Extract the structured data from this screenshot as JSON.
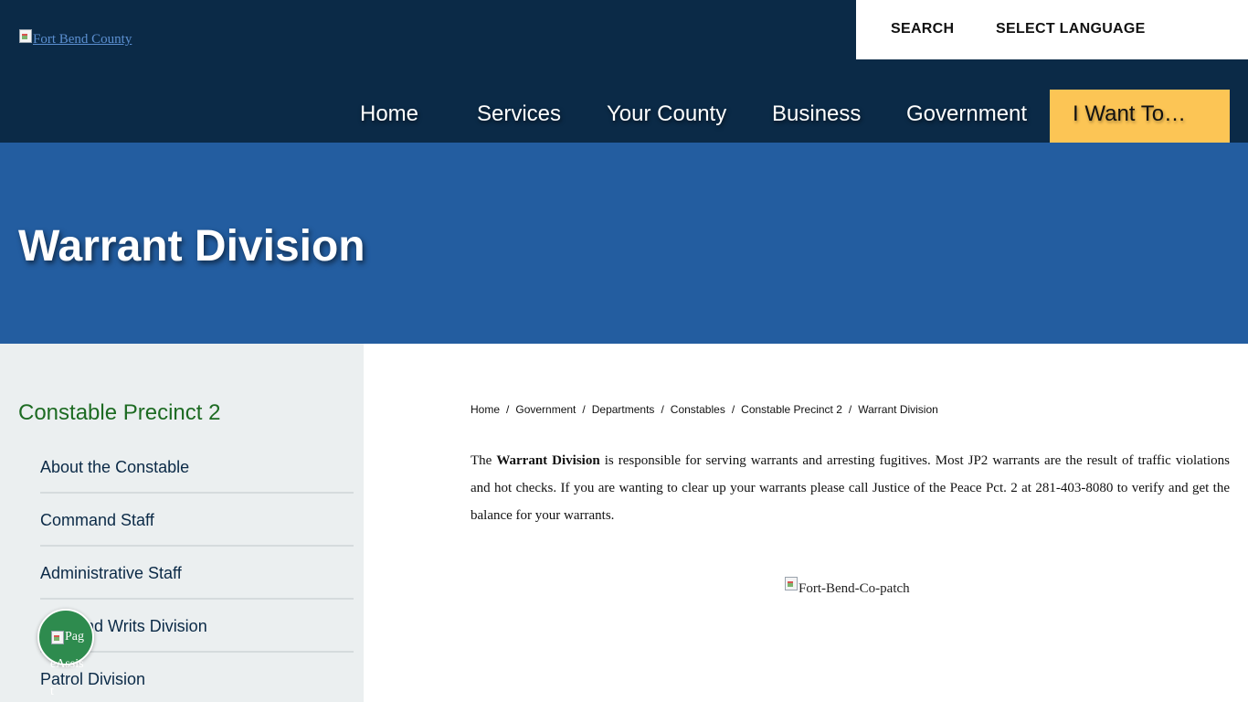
{
  "header": {
    "logo_alt": "Fort Bend County",
    "search_label": "SEARCH",
    "language_label": "SELECT LANGUAGE"
  },
  "nav": {
    "items": [
      {
        "label": "Home"
      },
      {
        "label": "Services"
      },
      {
        "label": "Your County"
      },
      {
        "label": "Business"
      },
      {
        "label": "Government"
      },
      {
        "label": "I Want To…"
      }
    ],
    "highlight_color": "#fcc555"
  },
  "hero": {
    "title": "Warrant Division",
    "bg_color": "#235da0"
  },
  "sidebar": {
    "title": "Constable Precinct 2",
    "items": [
      {
        "label": "About the Constable"
      },
      {
        "label": "Command Staff"
      },
      {
        "label": "Administrative Staff"
      },
      {
        "label": "Civil and Writs Division"
      },
      {
        "label": "Patrol Division"
      }
    ]
  },
  "accessibility": {
    "alt_text": "PageAssist"
  },
  "breadcrumb": {
    "items": [
      "Home",
      "Government",
      "Departments",
      "Constables",
      "Constable Precinct 2",
      "Warrant Division"
    ],
    "separator": "/"
  },
  "content": {
    "intro": "The ",
    "bold": "Warrant Division",
    "paragraph": " is responsible for serving warrants and arresting fugitives. Most JP2 warrants are the result of traffic violations and hot checks. If you are wanting to clear up your warrants please call Justice of the Peace Pct. 2 at 281-403-8080 to verify and get the balance for your warrants.",
    "image_alt": "Fort-Bend-Co-patch"
  }
}
